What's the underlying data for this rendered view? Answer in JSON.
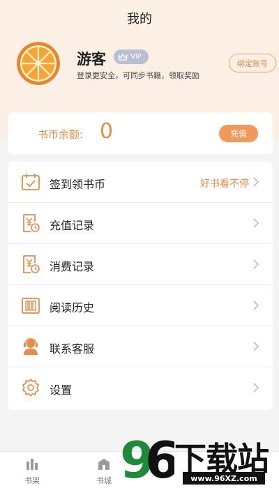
{
  "header": {
    "title": "我的"
  },
  "profile": {
    "username": "游客",
    "vip_label": "VIP",
    "subtitle": "登录更安全，可同步书籍，领取奖励",
    "bind_button": "绑定账号"
  },
  "balance": {
    "label": "书币余额:",
    "value": "0",
    "recharge_button": "充值"
  },
  "menu": [
    {
      "label": "签到领书币",
      "extra": "好书看不停",
      "icon": "calendar-check-icon"
    },
    {
      "label": "充值记录",
      "icon": "recharge-record-icon"
    },
    {
      "label": "消费记录",
      "icon": "consume-record-icon"
    },
    {
      "label": "阅读历史",
      "icon": "book-history-icon"
    },
    {
      "label": "联系客服",
      "icon": "customer-service-icon"
    },
    {
      "label": "设置",
      "icon": "gear-icon"
    }
  ],
  "tabbar": [
    {
      "label": "书架",
      "icon": "bookshelf-icon"
    },
    {
      "label": "书城",
      "icon": "bookstore-icon"
    }
  ],
  "watermark": {
    "brand": "下载站",
    "digits": "96",
    "url": "www.96XZ.com"
  },
  "colors": {
    "accent": "#ea8a45",
    "accent_fill": "#f0995a",
    "vip_badge": "#b9bfd3"
  }
}
